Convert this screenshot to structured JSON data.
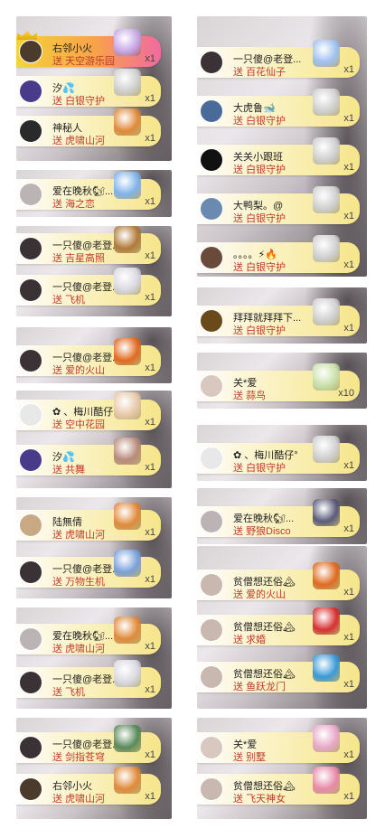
{
  "colors": {
    "bar_start": "#ffffff",
    "bar_end": "#f6e58a",
    "gift_text": "#c0392b",
    "fire_bar": [
      "#f6d338",
      "#f16aa0"
    ]
  },
  "left_column": {
    "panels": [
      [
        {
          "name": "右邻小火",
          "prefix": "送",
          "gift": "天空游乐园",
          "count": "x1",
          "style": "fire",
          "avatar": "#4b3b2c",
          "icon": "#c7a7e6",
          "icon_name": "castle-gift-icon",
          "crown": true
        },
        {
          "name": "汐💦",
          "prefix": "送",
          "gift": "白银守护",
          "count": "x1",
          "avatar": "#4a3a8a",
          "icon": "#cfcfcf",
          "icon_name": "silver-shield-gift-icon"
        },
        {
          "name": "神秘人",
          "prefix": "送",
          "gift": "虎啸山河",
          "count": "x1",
          "avatar": "#2a2a2a",
          "icon": "#e08a3a",
          "icon_name": "tiger-gift-icon"
        }
      ],
      [
        {
          "name": "爱在晚秋🐿...",
          "prefix": "送",
          "gift": "海之恋",
          "count": "x1",
          "avatar": "#bcb4b4",
          "icon": "#7fb3e8",
          "icon_name": "ocean-gift-icon"
        }
      ],
      [
        {
          "name": "一只傻@老登...",
          "prefix": "送",
          "gift": "吉星高照",
          "count": "x1",
          "avatar": "#3a3234",
          "icon": "#b07a3a",
          "icon_name": "star-gift-icon"
        },
        {
          "name": "一只傻@老登...",
          "prefix": "送",
          "gift": "飞机",
          "count": "x1",
          "avatar": "#3a3234",
          "icon": "#d8d8e0",
          "icon_name": "airplane-gift-icon"
        }
      ],
      [
        {
          "name": "一只傻@老登...",
          "prefix": "送",
          "gift": "爱的火山",
          "count": "x1",
          "avatar": "#3a3234",
          "icon": "#e06a20",
          "icon_name": "volcano-gift-icon"
        }
      ],
      [
        {
          "name": "✿ 、梅川酷仔°",
          "prefix": "送",
          "gift": "空中花园",
          "count": "x1",
          "avatar": "#e8e8e8",
          "icon": "#e8c8a8",
          "icon_name": "garden-gift-icon"
        },
        {
          "name": "汐💦",
          "prefix": "送",
          "gift": "共舞",
          "count": "x1",
          "avatar": "#4a3a8a",
          "icon": "#b88a7a",
          "icon_name": "dance-gift-icon"
        }
      ],
      [
        {
          "name": "陆無倩",
          "prefix": "送",
          "gift": "虎啸山河",
          "count": "x1",
          "avatar": "#c9a884",
          "icon": "#e08a3a",
          "icon_name": "tiger-gift-icon"
        },
        {
          "name": "一只傻@老登...",
          "prefix": "送",
          "gift": "万物生机",
          "count": "x1",
          "avatar": "#3a3234",
          "icon": "#7aa0d8",
          "icon_name": "nature-gift-icon"
        }
      ],
      [
        {
          "name": "爱在晚秋🐿...",
          "prefix": "送",
          "gift": "虎啸山河",
          "count": "x1",
          "avatar": "#bcb4b4",
          "icon": "#e08a3a",
          "icon_name": "tiger-gift-icon"
        },
        {
          "name": "一只傻@老登...",
          "prefix": "送",
          "gift": "飞机",
          "count": "x1",
          "avatar": "#3a3234",
          "icon": "#d8d8e0",
          "icon_name": "airplane-gift-icon"
        }
      ],
      [
        {
          "name": "一只傻@老登...",
          "prefix": "送",
          "gift": "剑指苍穹",
          "count": "x1",
          "avatar": "#3a3234",
          "icon": "#5a8a5a",
          "icon_name": "sword-gift-icon"
        },
        {
          "name": "右邻小火",
          "prefix": "送",
          "gift": "虎啸山河",
          "count": "x1",
          "avatar": "#4b3b2c",
          "icon": "#e08a3a",
          "icon_name": "tiger-gift-icon"
        }
      ]
    ]
  },
  "right_column": {
    "panels": [
      [
        {
          "name": "一只傻@老登...",
          "prefix": "送",
          "gift": "百花仙子",
          "count": "x1",
          "avatar": "#3a3234",
          "icon": "#9fc0f0",
          "icon_name": "fairy-gift-icon"
        },
        {
          "name": "大虎鲁🐋",
          "prefix": "送",
          "gift": "白银守护",
          "count": "x1",
          "avatar": "#4a6a9a",
          "icon": "#cfcfcf",
          "icon_name": "silver-shield-gift-icon"
        },
        {
          "name": "关关小跟班",
          "prefix": "送",
          "gift": "白银守护",
          "count": "x1",
          "avatar": "#111111",
          "icon": "#cfcfcf",
          "icon_name": "silver-shield-gift-icon"
        },
        {
          "name": "大鸭梨。@",
          "prefix": "送",
          "gift": "白银守护",
          "count": "x1",
          "avatar": "#6a8ab0",
          "icon": "#cfcfcf",
          "icon_name": "silver-shield-gift-icon"
        },
        {
          "name": "。。。。⚡🔥",
          "prefix": "送",
          "gift": "白银守护",
          "count": "x1",
          "avatar": "#6a4a3a",
          "icon": "#cfcfcf",
          "icon_name": "silver-shield-gift-icon"
        }
      ],
      [
        {
          "name": "拜拜就拜拜下...",
          "prefix": "送",
          "gift": "白银守护",
          "count": "x1",
          "avatar": "#6a4a1a",
          "icon": "#cfcfcf",
          "icon_name": "silver-shield-gift-icon"
        }
      ],
      [
        {
          "name": "关*爱",
          "prefix": "送",
          "gift": "蒜鸟",
          "count": "x10",
          "avatar": "#d8c8c0",
          "icon": "#c8e0a8",
          "icon_name": "garlic-bird-gift-icon"
        }
      ],
      [
        {
          "name": "✿ 、梅川酷仔°",
          "prefix": "送",
          "gift": "白银守护",
          "count": "x1",
          "avatar": "#e8e8e8",
          "icon": "#cfcfcf",
          "icon_name": "silver-shield-gift-icon"
        }
      ],
      [
        {
          "name": "爱在晚秋🐿...",
          "prefix": "送",
          "gift": "野狼Disco",
          "count": "x1",
          "avatar": "#bcb4b4",
          "icon": "#5a5a7a",
          "icon_name": "wolf-gift-icon"
        }
      ],
      [
        {
          "name": "贫僧想还俗🏔",
          "prefix": "送",
          "gift": "爱的火山",
          "count": "x1",
          "avatar": "#c8b8b0",
          "icon": "#e06a20",
          "icon_name": "volcano-gift-icon"
        },
        {
          "name": "贫僧想还俗🏔",
          "prefix": "送",
          "gift": "求婚",
          "count": "x1",
          "avatar": "#c8b8b0",
          "icon": "#d83030",
          "icon_name": "ring-box-gift-icon"
        },
        {
          "name": "贫僧想还俗🏔",
          "prefix": "送",
          "gift": "鱼跃龙门",
          "count": "x1",
          "avatar": "#c8b8b0",
          "icon": "#3a9ad8",
          "icon_name": "dragon-gate-gift-icon"
        }
      ],
      [
        {
          "name": "关*爱",
          "prefix": "送",
          "gift": "别墅",
          "count": "x1",
          "avatar": "#d8c8c0",
          "icon": "#e8a8c8",
          "icon_name": "villa-gift-icon"
        },
        {
          "name": "贫僧想还俗🏔",
          "prefix": "送",
          "gift": "飞天神女",
          "count": "x1",
          "avatar": "#c8b8b0",
          "icon": "#e88aa8",
          "icon_name": "goddess-gift-icon"
        }
      ]
    ]
  }
}
